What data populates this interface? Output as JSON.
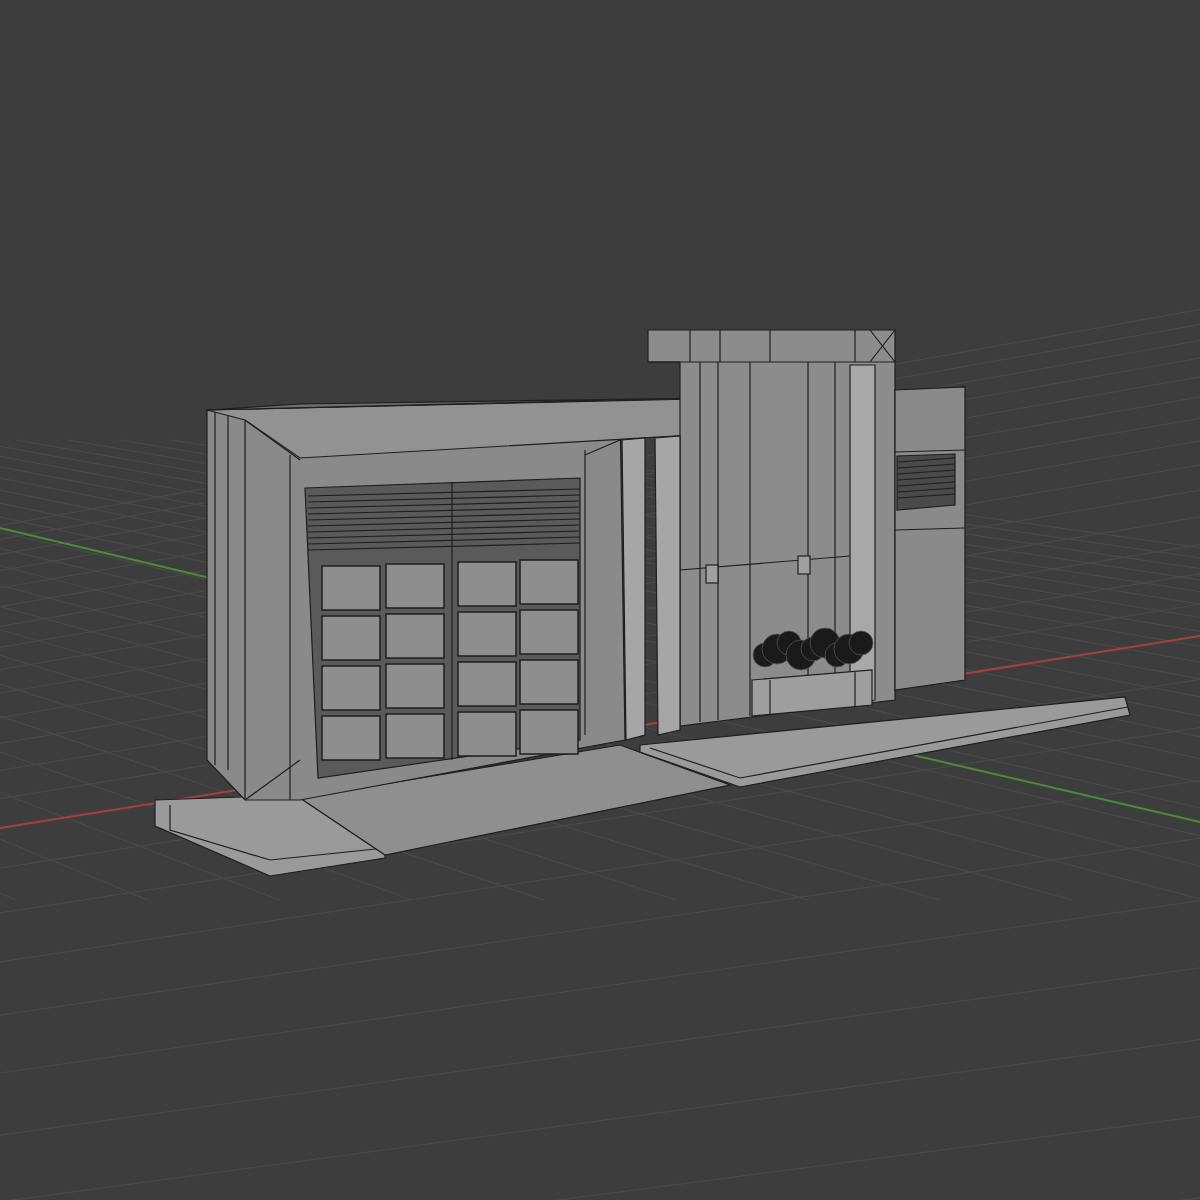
{
  "viewport": {
    "kind": "perspective"
  },
  "axes": [
    {
      "color": "#a4403e"
    },
    {
      "color": "#4f8a3a"
    }
  ]
}
